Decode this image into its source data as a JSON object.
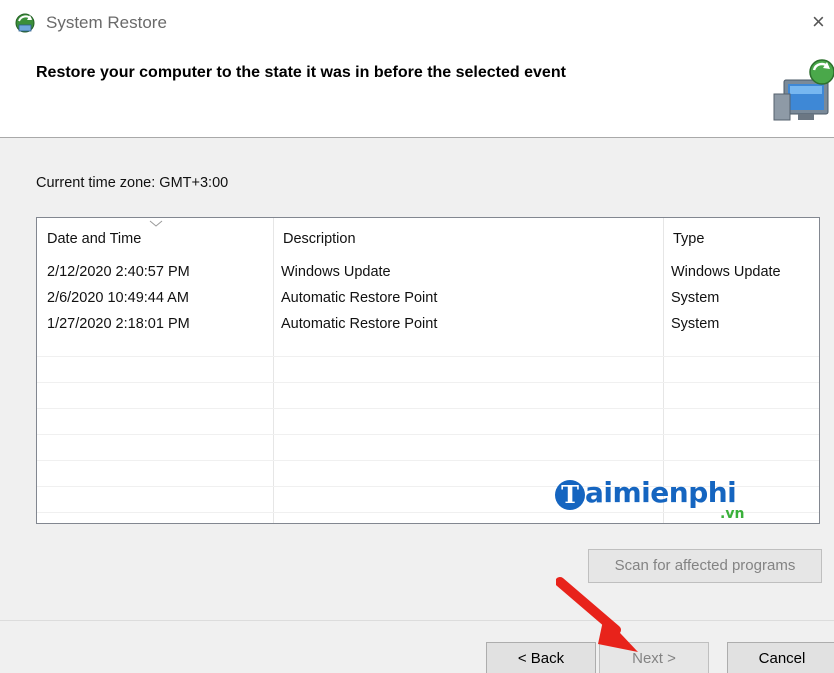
{
  "window": {
    "title": "System Restore",
    "close_glyph": "×"
  },
  "header": {
    "title": "Restore your computer to the state it was in before the selected event"
  },
  "timezone": {
    "label": "Current time zone: GMT+3:00"
  },
  "table": {
    "columns": [
      "Date and Time",
      "Description",
      "Type"
    ],
    "sorted_column": "Date and Time",
    "rows": [
      {
        "date": "2/12/2020 2:40:57 PM",
        "description": "Windows Update",
        "type": "Windows Update"
      },
      {
        "date": "2/6/2020 10:49:44 AM",
        "description": "Automatic Restore Point",
        "type": "System"
      },
      {
        "date": "1/27/2020 2:18:01 PM",
        "description": "Automatic Restore Point",
        "type": "System"
      }
    ]
  },
  "watermark": {
    "initial": "T",
    "text": "aimienphi",
    "suffix": ".vn"
  },
  "buttons": {
    "scan": "Scan for affected programs",
    "back": "< Back",
    "next": "Next >",
    "cancel": "Cancel"
  },
  "colors": {
    "watermark_blue": "#1565c0",
    "watermark_green": "#3ab03a",
    "annotation_arrow": "#e8231b"
  },
  "icons": {
    "title": "system-restore-icon",
    "header": "restore-monitor-icon",
    "annotation": "red-pointer-arrow"
  }
}
